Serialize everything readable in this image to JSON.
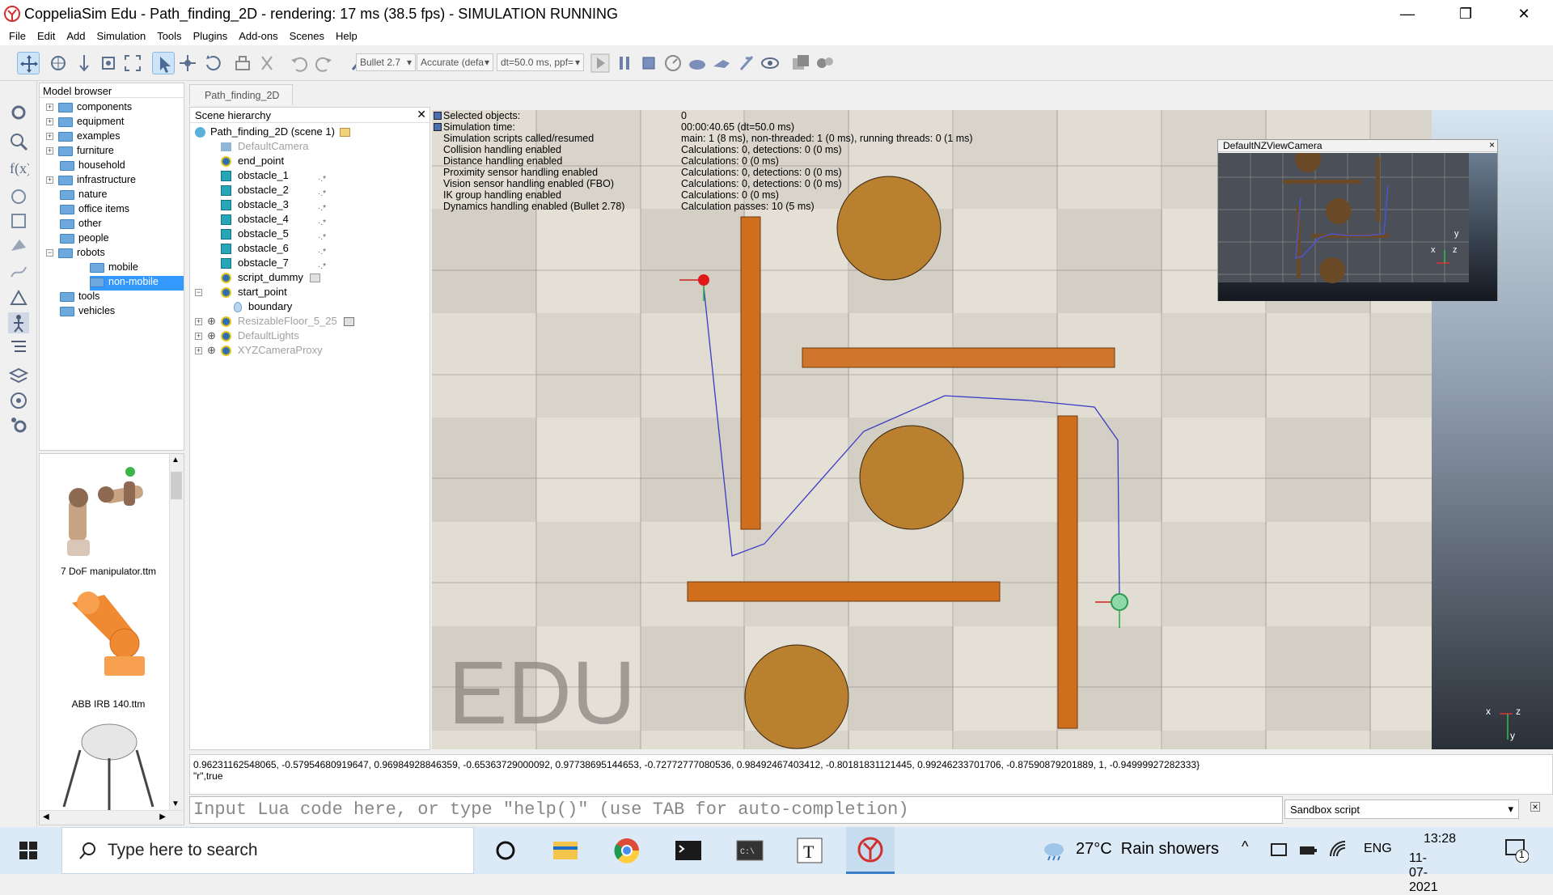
{
  "window": {
    "title": "CoppeliaSim Edu - Path_finding_2D - rendering: 17 ms (38.5 fps) - SIMULATION RUNNING",
    "minimize": "—",
    "restore": "❐",
    "close": "✕"
  },
  "menu": [
    "File",
    "Edit",
    "Add",
    "Simulation",
    "Tools",
    "Plugins",
    "Add-ons",
    "Scenes",
    "Help"
  ],
  "toolbar": {
    "engine": "Bullet 2.7",
    "accuracy": "Accurate (defa",
    "timestep": "dt=50.0 ms, ppf="
  },
  "model_browser": {
    "title": "Model browser",
    "items": [
      "components",
      "equipment",
      "examples",
      "furniture",
      "household",
      "infrastructure",
      "nature",
      "office items",
      "other",
      "people",
      "robots",
      "mobile",
      "non-mobile",
      "tools",
      "vehicles"
    ],
    "thumbs": [
      "7 DoF manipulator.ttm",
      "ABB IRB 140.ttm"
    ]
  },
  "scene_tab": "Path_finding_2D",
  "hierarchy": {
    "title": "Scene hierarchy",
    "root": "Path_finding_2D (scene 1)",
    "items": [
      "DefaultCamera",
      "end_point",
      "obstacle_1",
      "obstacle_2",
      "obstacle_3",
      "obstacle_4",
      "obstacle_5",
      "obstacle_6",
      "obstacle_7",
      "script_dummy",
      "start_point",
      "boundary",
      "ResizableFloor_5_25",
      "DefaultLights",
      "XYZCameraProxy"
    ]
  },
  "info_panel": {
    "keys": [
      "Selected objects:",
      "Simulation time:",
      "Simulation scripts called/resumed",
      "Collision handling enabled",
      "Distance handling enabled",
      "Proximity sensor handling enabled",
      "Vision sensor handling enabled (FBO)",
      "IK group handling enabled",
      "Dynamics handling enabled (Bullet 2.78)"
    ],
    "values": [
      "0",
      "00:00:40.65 (dt=50.0 ms)",
      "main: 1 (8 ms), non-threaded: 1 (0 ms), running threads: 0 (1 ms)",
      "Calculations: 0, detections: 0 (0 ms)",
      "Calculations: 0 (0 ms)",
      "Calculations: 0, detections: 0 (0 ms)",
      "Calculations: 0, detections: 0 (0 ms)",
      "Calculations: 0 (0 ms)",
      "Calculation passes: 10 (5 ms)"
    ]
  },
  "viewport": {
    "watermark": "EDU",
    "axis_x": "x",
    "axis_z": "z",
    "axis_y": "y"
  },
  "float_camera": {
    "title": "DefaultNZViewCamera",
    "close": "×",
    "axis_x": "x",
    "axis_y": "y",
    "axis_z": "z"
  },
  "console": {
    "line1": "0.96231162548065, -0.57954680919647, 0.96984928846359, -0.65363729000092, 0.97738695144653, -0.72772777080536, 0.98492467403412, -0.80181831121445, 0.99246233701706, -0.87590879201889, 1, -0.94999927282333}",
    "line2": "\"r\",true"
  },
  "lua_input": {
    "placeholder": "Input Lua code here, or type \"help()\" (use TAB for auto-completion)"
  },
  "script_select": "Sandbox script",
  "taskbar": {
    "search": "Type here to search",
    "weather": "27°C  Rain showers",
    "lang": "ENG",
    "time": "13:28",
    "date": "11-07-2021",
    "notif": "1"
  }
}
